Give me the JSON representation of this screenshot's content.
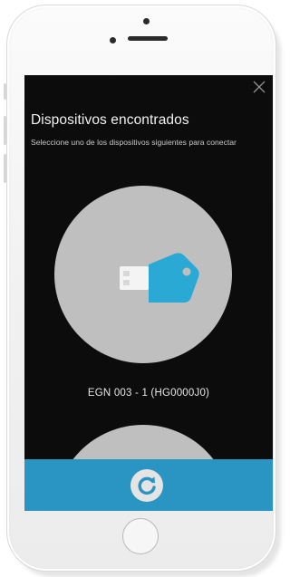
{
  "app": {
    "title": "Dispositivos encontrados",
    "subtitle": "Seleccione uno de los dispositivos siguientes para conectar"
  },
  "devices": [
    {
      "name": "EGN 003 - 1 (HG0000J0)",
      "icon": "usb-key-icon"
    }
  ],
  "icons": {
    "close": "close-icon",
    "refresh": "refresh-icon"
  },
  "colors": {
    "screen_background": "#0c0c0c",
    "device_circle": "#bfbfbf",
    "accent_blue": "#2a94c2",
    "usb_key_blue": "#2aa9d4",
    "refresh_icon": "#2a94c2"
  }
}
